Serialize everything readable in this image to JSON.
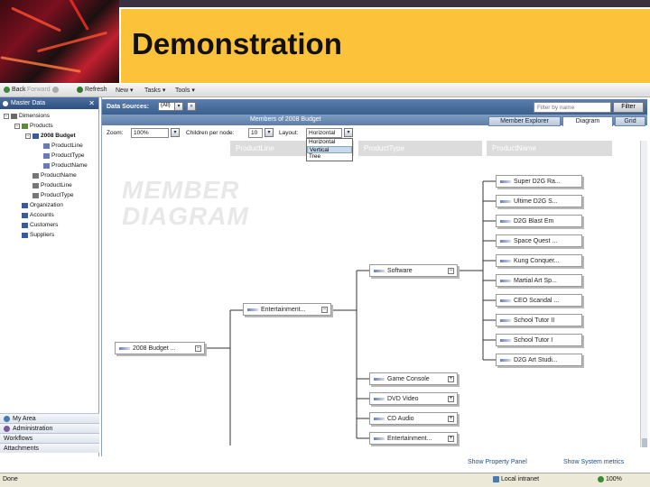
{
  "slide": {
    "title": "Demonstration"
  },
  "toolbar": {
    "back": "Back",
    "forward": "Forward",
    "refresh": "Refresh",
    "new": "New",
    "tasks": "Tasks",
    "tools": "Tools"
  },
  "left_pane": {
    "header": "Master Data",
    "close": "✕",
    "tree": [
      {
        "label": "Dimensions",
        "toggle": "−"
      },
      {
        "label": "Products",
        "toggle": "−"
      },
      {
        "label": "2008 Budget",
        "toggle": "−"
      },
      {
        "label": "ProductLine"
      },
      {
        "label": "ProductType"
      },
      {
        "label": "ProductName"
      },
      {
        "label": "ProductName"
      },
      {
        "label": "ProductLine"
      },
      {
        "label": "ProductType"
      },
      {
        "label": "Organization"
      },
      {
        "label": "Accounts"
      },
      {
        "label": "Customers"
      },
      {
        "label": "Suppliers"
      }
    ],
    "nav": [
      "My Area",
      "Administration",
      "Workflows",
      "Attachments"
    ]
  },
  "main": {
    "data_sources_label": "Data Sources:",
    "data_sources_value": "(All)",
    "filter_placeholder": "Filter by name",
    "filter_button": "Filter",
    "members_title": "Members of 2008 Budget",
    "tabs": [
      "Member Explorer",
      "Diagram",
      "Grid"
    ],
    "zoom_label": "Zoom:",
    "zoom_value": "100%",
    "children_label": "Children per node:",
    "children_value": "10",
    "layout_label": "Layout:",
    "layout_value": "Horizontal",
    "layout_options": [
      "Horizontal",
      "Vertical",
      "Tree"
    ],
    "columns": [
      "ProductLine",
      "ProductType",
      "ProductName"
    ],
    "watermark_line1": "MEMBER",
    "watermark_line2": "DIAGRAM",
    "nodes": {
      "root": "2008 Budget ...",
      "entertainment": "Entertainment...",
      "software": "Software",
      "game_console": "Game Console",
      "dvd_video": "DVD Video",
      "cd_audio": "CD Audio",
      "entertainment2": "Entertainment...",
      "leaves": [
        "Super D2G Ra...",
        "Ultime D2G S...",
        "D2G Blast Em",
        "Space Quest ...",
        "Kung Conquer...",
        "Martial Art Sp...",
        "CEO Scandal ...",
        "School Tutor II",
        "School Tutor I",
        "D2G Art Studi..."
      ]
    },
    "toggle_minus": "−",
    "toggle_plus": "+"
  },
  "bottom_links": {
    "property": "Show Property Panel",
    "metrics": "Show System metrics"
  },
  "status": {
    "left": "Done",
    "zone": "Local intranet",
    "zoom": "100%"
  }
}
